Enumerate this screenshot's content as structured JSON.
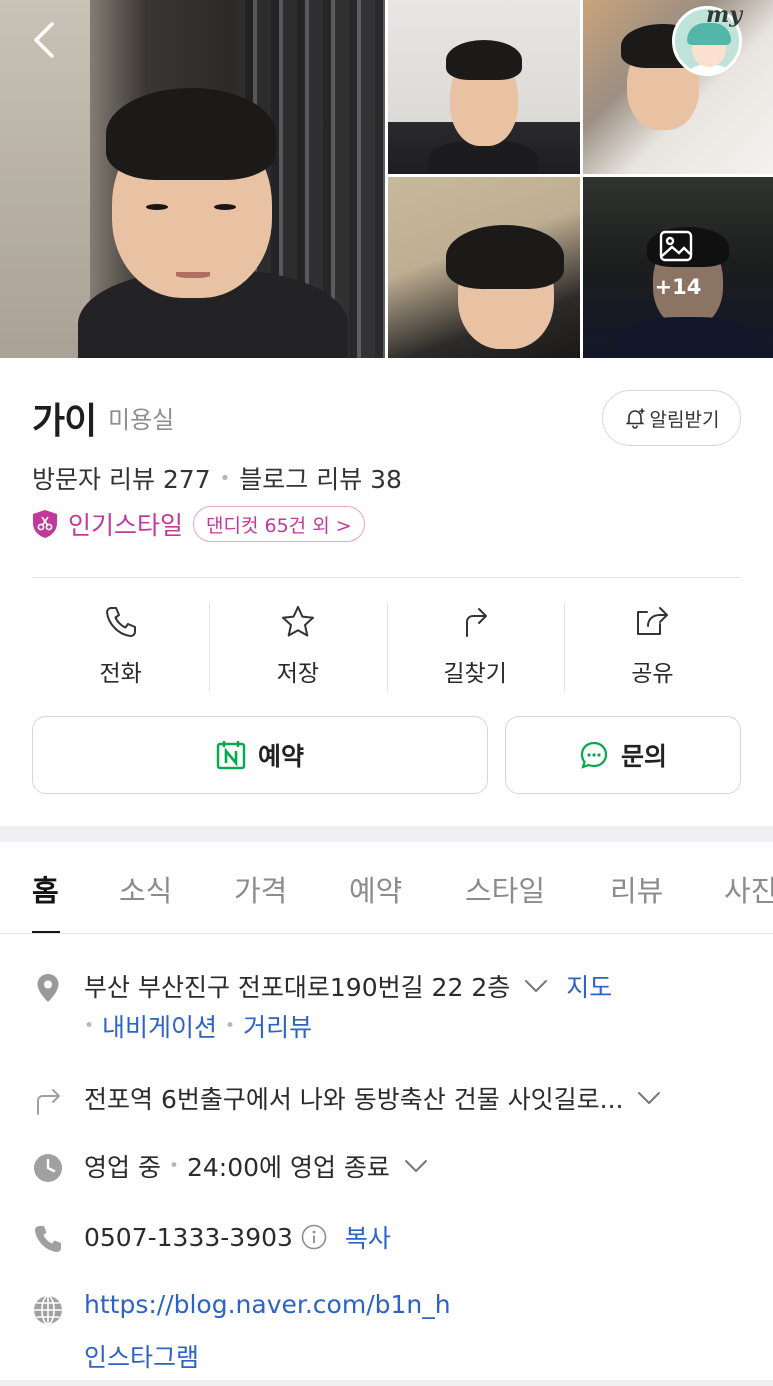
{
  "gallery": {
    "more_count": "+14",
    "my_label": "my"
  },
  "place": {
    "name": "가이",
    "category": "미용실",
    "alarm_label": "알림받기",
    "visitor_reviews": "방문자 리뷰 277",
    "blog_reviews": "블로그 리뷰 38",
    "popular_label": "인기스타일",
    "popular_pill": "댄디컷 65건 외 >"
  },
  "actions": [
    {
      "label": "전화",
      "icon": "phone-icon"
    },
    {
      "label": "저장",
      "icon": "star-icon"
    },
    {
      "label": "길찾기",
      "icon": "directions-icon"
    },
    {
      "label": "공유",
      "icon": "share-icon"
    }
  ],
  "buttons": {
    "reserve": "예약",
    "inquiry": "문의"
  },
  "tabs": [
    "홈",
    "소식",
    "가격",
    "예약",
    "스타일",
    "리뷰",
    "사진"
  ],
  "details": {
    "address": "부산 부산진구 전포대로190번길 22 2층",
    "map_link": "지도",
    "navigation_link": "내비게이션",
    "street_view_link": "거리뷰",
    "directions_text": "전포역 6번출구에서 나와 동방축산 건물 사잇길로...",
    "hours_status": "영업 중",
    "hours_text": "24:00에 영업 종료",
    "phone": "0507-1333-3903",
    "copy_label": "복사",
    "homepage": "https://blog.naver.com/b1n_h",
    "instagram": "인스타그램"
  },
  "colors": {
    "accent_blue": "#2d63c5",
    "popular_pink": "#c2399c",
    "naver_green": "#03a94d"
  }
}
